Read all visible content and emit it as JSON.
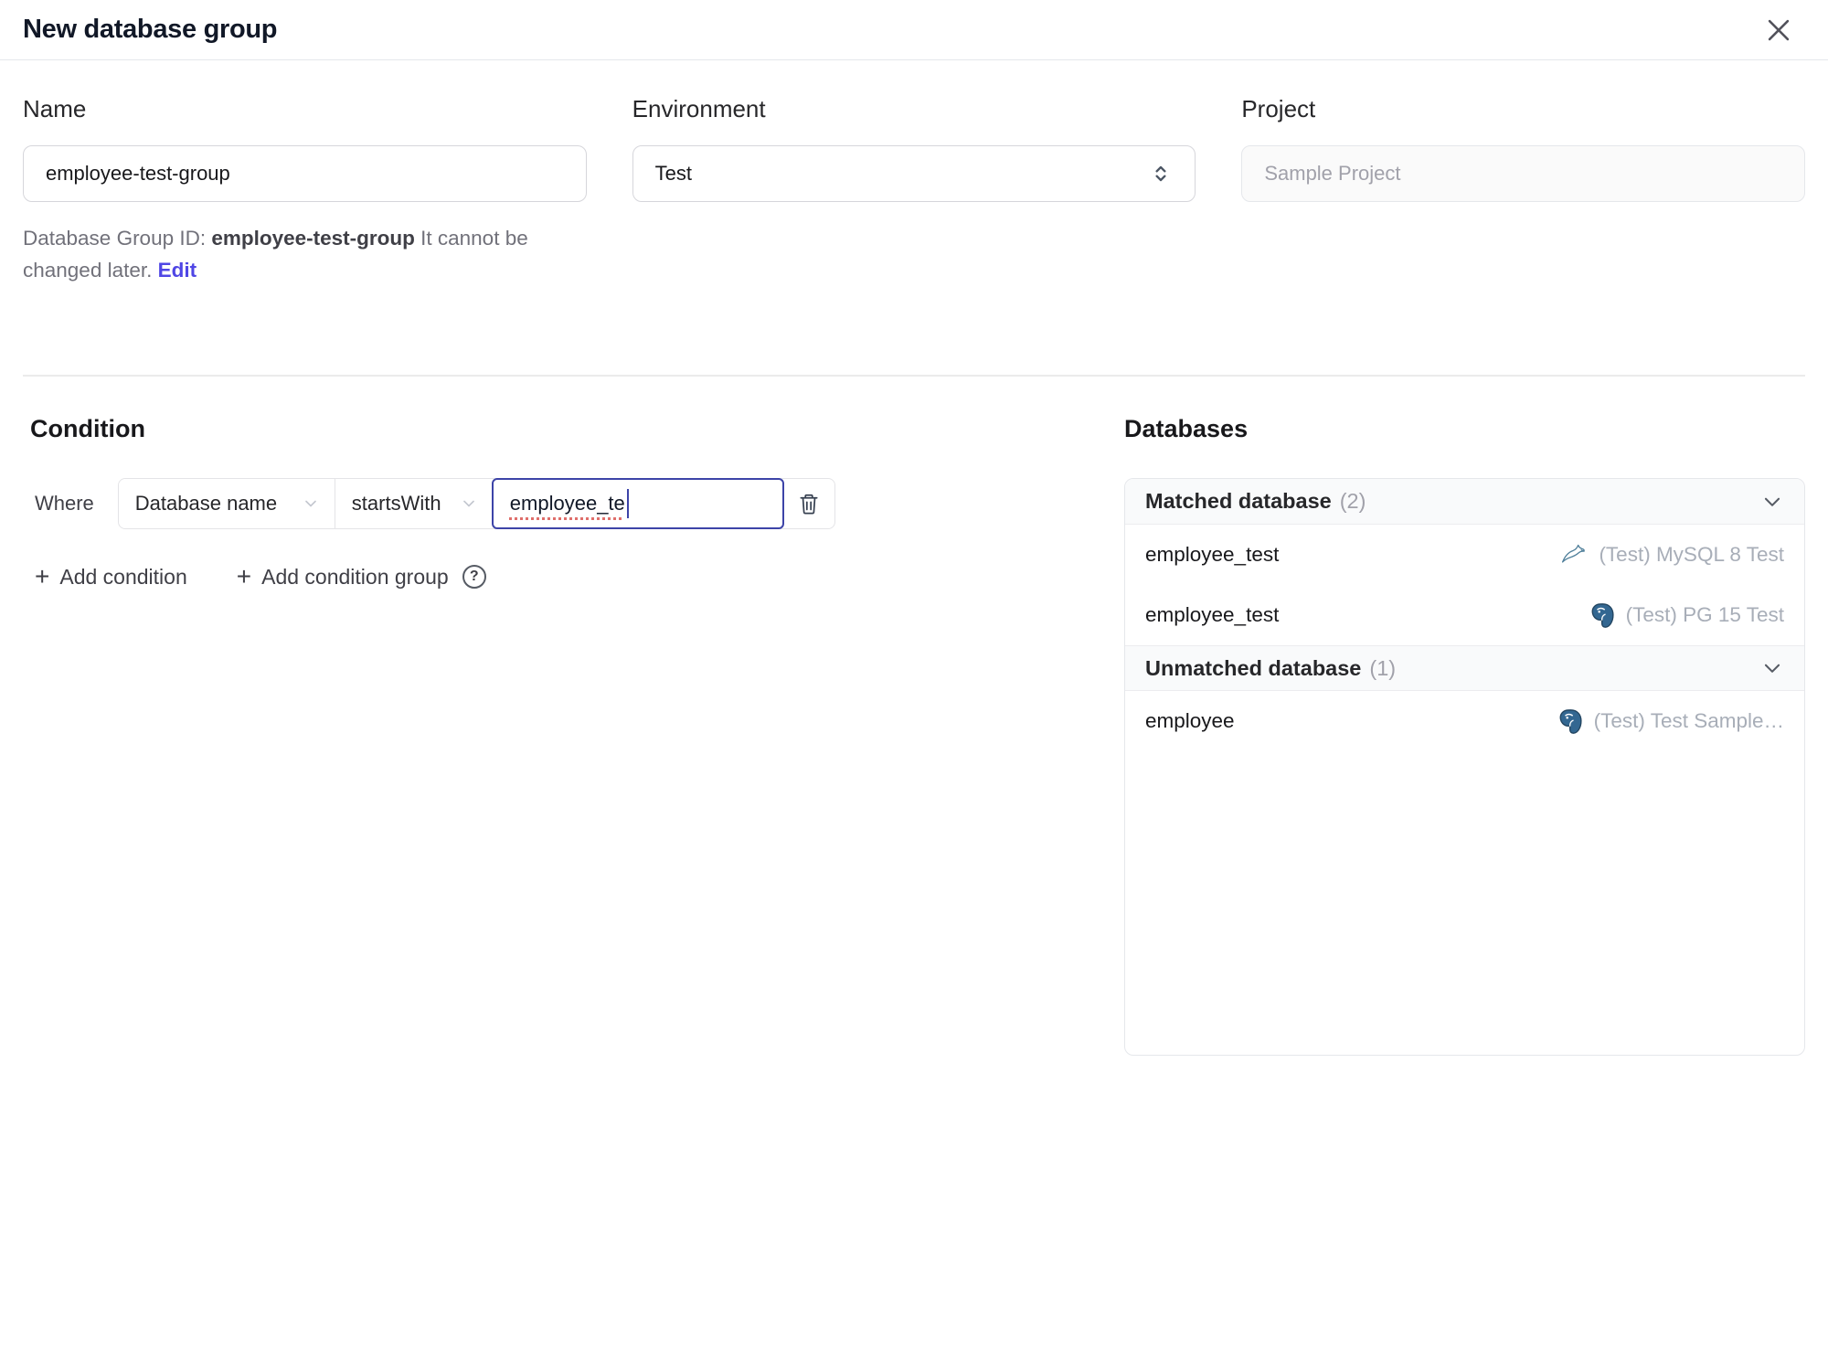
{
  "dialog": {
    "title": "New database group"
  },
  "form": {
    "name_label": "Name",
    "name_value": "employee-test-group",
    "environment_label": "Environment",
    "environment_value": "Test",
    "project_label": "Project",
    "project_value": "Sample Project",
    "group_id_prefix": "Database Group ID: ",
    "group_id_value": "employee-test-group",
    "group_id_suffix": " It cannot be changed later. ",
    "edit_link": "Edit"
  },
  "condition": {
    "heading": "Condition",
    "where_label": "Where",
    "field_selected": "Database name",
    "operator_selected": "startsWith",
    "value_text": "employee_te",
    "add_condition": "Add condition",
    "add_condition_group": "Add condition group",
    "help_glyph": "?",
    "plus_glyph": "+"
  },
  "databases": {
    "heading": "Databases",
    "sections": [
      {
        "title": "Matched database",
        "count": "(2)",
        "rows": [
          {
            "name": "employee_test",
            "engine_icon": "mysql-icon",
            "instance": "(Test) MySQL 8 Test"
          },
          {
            "name": "employee_test",
            "engine_icon": "postgresql-icon",
            "instance": "(Test) PG 15 Test"
          }
        ]
      },
      {
        "title": "Unmatched database",
        "count": "(1)",
        "rows": [
          {
            "name": "employee",
            "engine_icon": "postgresql-icon",
            "instance": "(Test) Test Sample…"
          }
        ]
      }
    ]
  },
  "colors": {
    "accent": "#4f46e5",
    "focus_border": "#3d44a8",
    "spellcheck_underline": "#df6f6b",
    "section_header_bg": "#f9fafb",
    "panel_border": "#e5e7eb",
    "muted_text": "#a8aeb8",
    "mysql_icon": "#4f7f9a",
    "postgresql_icon": "#336791"
  }
}
